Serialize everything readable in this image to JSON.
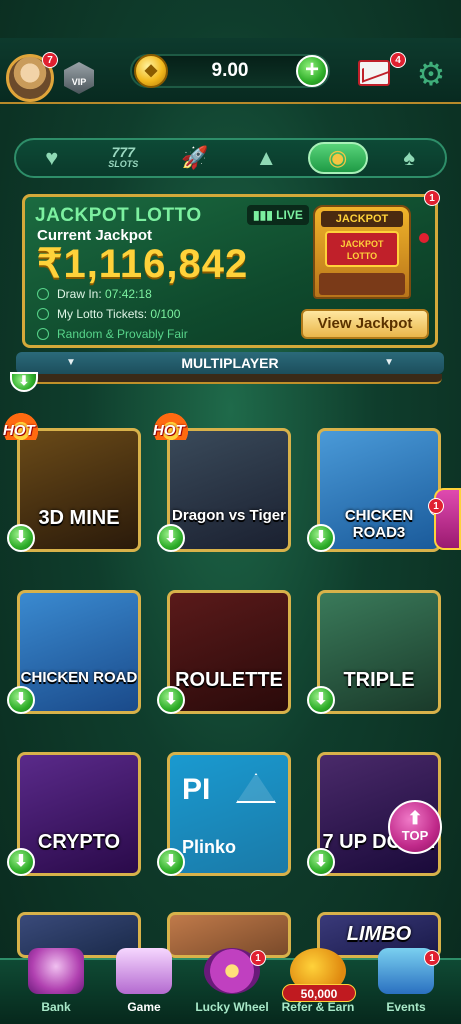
{
  "header": {
    "avatar_badge": "7",
    "vip_label": "VIP",
    "balance": "9.00",
    "mail_badge": "4",
    "icons": [
      "avatar",
      "vip-shield-icon",
      "coin-icon",
      "plus-icon",
      "mail-icon",
      "gear-icon"
    ]
  },
  "tabs": [
    {
      "name": "favorites",
      "icon": "heart-icon",
      "active": false
    },
    {
      "name": "slots",
      "label_top": "777",
      "label_bottom": "SLOTS",
      "active": false
    },
    {
      "name": "crash",
      "icon": "rocket-icon",
      "active": false
    },
    {
      "name": "fishing",
      "icon": "shark-icon",
      "active": false
    },
    {
      "name": "table",
      "icon": "roulette-icon",
      "active": true
    },
    {
      "name": "cards",
      "icon": "cards-icon",
      "active": false
    }
  ],
  "jackpot": {
    "title": "JACKPOT LOTTO",
    "live_label": "LIVE",
    "badge": "1",
    "current_label": "Current Jackpot",
    "amount": "₹1,116,842",
    "draw_label": "Draw In:",
    "draw_value": "07:42:18",
    "tickets_label": "My Lotto Tickets:",
    "tickets_value": "0/100",
    "fair_label": "Random & Provably Fair",
    "machine_top": "JACKPOT",
    "machine_screen_1": "JACKPOT",
    "machine_screen_2": "LOTTO",
    "view_button": "View Jackpot"
  },
  "section": {
    "title": "MULTIPLAYER"
  },
  "games": [
    {
      "title": "3D MINE",
      "hot": true,
      "colors": [
        "#6a4a18",
        "#2a1a0a"
      ],
      "text_color": "#ffffff"
    },
    {
      "title": "Dragon vs Tiger",
      "hot": true,
      "colors": [
        "#3a4a5a",
        "#1a2030"
      ],
      "text_color": "#ffffff"
    },
    {
      "title": "CHICKEN ROAD3",
      "hot": false,
      "badge": "1",
      "colors": [
        "#4a9ad8",
        "#1a5a9a"
      ],
      "text_color": "#ffffff"
    },
    {
      "title": "CHICKEN ROAD",
      "hot": false,
      "colors": [
        "#3a8ad0",
        "#1a4a8a"
      ],
      "text_color": "#ffffff"
    },
    {
      "title": "ROULETTE",
      "hot": false,
      "colors": [
        "#5a1a1a",
        "#2a0a0a"
      ],
      "text_color": "#ffffff"
    },
    {
      "title": "TRIPLE",
      "hot": false,
      "colors": [
        "#3a7a5a",
        "#1a3a2a"
      ],
      "text_color": "#ffffff"
    },
    {
      "title": "CRYPTO",
      "hot": false,
      "colors": [
        "#5a2a8a",
        "#2a0a4a"
      ],
      "text_color": "#ffffff"
    },
    {
      "title": "Plinko",
      "abbr": "PI",
      "hot": false,
      "colors": [
        "#1a9ad0",
        "#1a7aa8"
      ],
      "text_color": "#ffffff"
    },
    {
      "title": "7 UP DOWN",
      "hot": false,
      "colors": [
        "#4a2a6a",
        "#1a0a3a"
      ],
      "text_color": "#ffffff"
    }
  ],
  "partial_games": [
    {
      "title": "",
      "colors": [
        "#3a4a7a",
        "#1a2a4a"
      ]
    },
    {
      "title": "",
      "colors": [
        "#c07a4a",
        "#7a4a2a"
      ]
    },
    {
      "title": "LIMBO",
      "colors": [
        "#3a3a7a",
        "#1a1a4a"
      ]
    }
  ],
  "top_button": {
    "label": "TOP"
  },
  "side_badge": "1",
  "bottom_nav": [
    {
      "label": "Bank",
      "active": false,
      "icon": "bank-icon"
    },
    {
      "label": "Game",
      "active": true,
      "icon": "slot-machine-icon"
    },
    {
      "label": "Lucky Wheel",
      "active": false,
      "icon": "wheel-icon",
      "badge": "1"
    },
    {
      "label": "Refer & Earn",
      "active": false,
      "icon": "refer-icon",
      "amount": "50,000"
    },
    {
      "label": "Events",
      "active": false,
      "icon": "gift-icon",
      "badge": "1"
    }
  ],
  "colors": {
    "accent_gold": "#d4a93a",
    "accent_green": "#7cf0a0",
    "jackpot_gold": "#ffd23a"
  }
}
